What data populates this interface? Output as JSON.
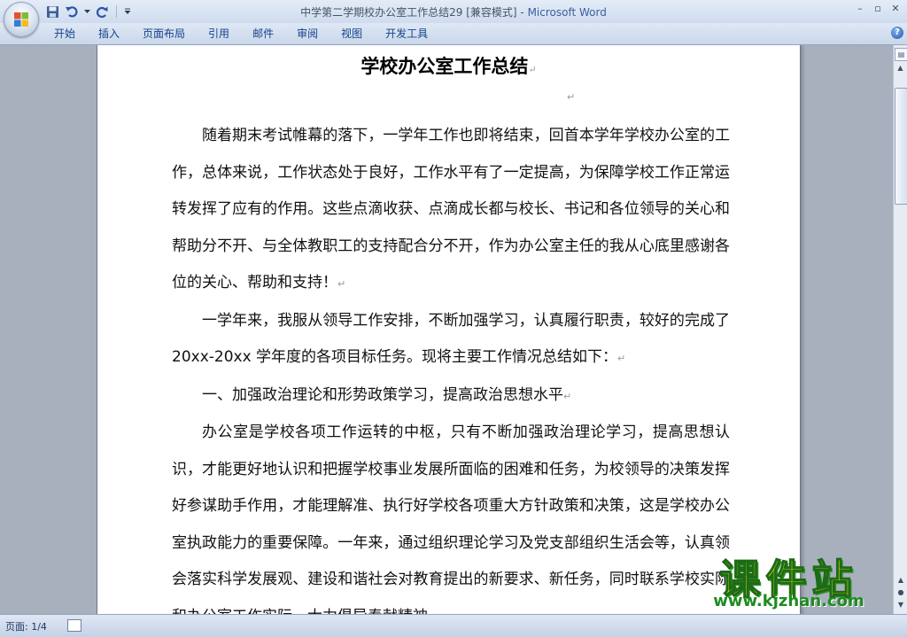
{
  "window": {
    "title": "中学第二学期校办公室工作总结29 [兼容模式]",
    "app_name": "Microsoft Word",
    "separator": " - "
  },
  "ribbon": {
    "tabs": [
      "开始",
      "插入",
      "页面布局",
      "引用",
      "邮件",
      "审阅",
      "视图",
      "开发工具"
    ]
  },
  "icons": {
    "office_button": "office-logo-icon",
    "save": "save-icon",
    "undo": "undo-icon",
    "redo": "redo-icon",
    "customize": "dropdown-icon",
    "help": "help-icon"
  },
  "window_controls": {
    "minimize": "–",
    "restore": "▫",
    "close": "✕"
  },
  "document": {
    "title": "学校办公室工作总结",
    "paragraphs": [
      "随着期末考试帷幕的落下，一学年工作也即将结束，回首本学年学校办公室的工作，总体来说，工作状态处于良好，工作水平有了一定提高，为保障学校工作正常运转发挥了应有的作用。这些点滴收获、点滴成长都与校长、书记和各位领导的关心和帮助分不开、与全体教职工的支持配合分不开，作为办公室主任的我从心底里感谢各位的关心、帮助和支持！",
      "一学年来，我服从领导工作安排，不断加强学习，认真履行职责，较好的完成了 20xx-20xx 学年度的各项目标任务。现将主要工作情况总结如下：",
      "一、加强政治理论和形势政策学习，提高政治思想水平",
      "办公室是学校各项工作运转的中枢，只有不断加强政治理论学习，提高思想认识，才能更好地认识和把握学校事业发展所面临的困难和任务，为校领导的决策发挥好参谋助手作用，才能理解准、执行好学校各项重大方针政策和决策，这是学校办公室执政能力的重要保障。一年来，通过组织理论学习及党支部组织生活会等，认真领会落实科学发展观、建设和谐社会对教育提出的新要求、新任务，同时联系学校实际和办公室工作实际，大力倡导奉献精神"
    ],
    "paragraph_mark": "↵"
  },
  "watermark": {
    "name": "课件站",
    "url": "www.kjzhan.com"
  },
  "status": {
    "page": "页面: 1/4"
  },
  "colors": {
    "ribbon_text": "#15428b",
    "title_app": "#3b5f9e",
    "watermark_fill": "#f4df12",
    "watermark_url": "#1e8b1e"
  }
}
